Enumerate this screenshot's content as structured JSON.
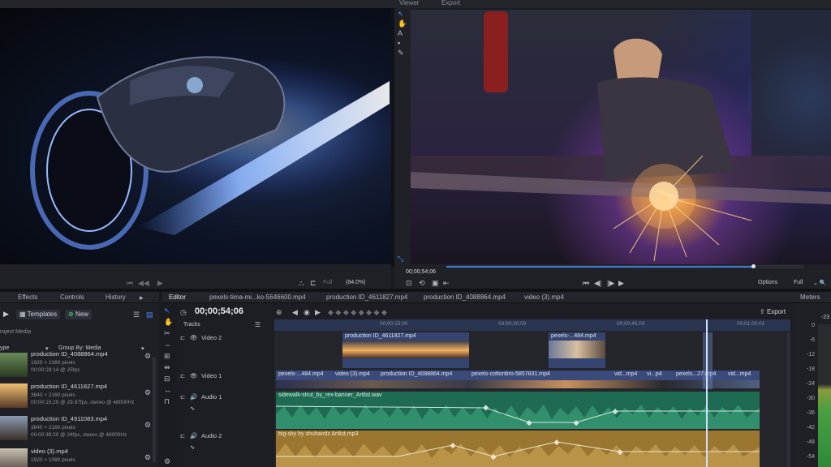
{
  "top": {
    "viewer_tab": "Viewer",
    "export_tab": "Export"
  },
  "source_viewer": {
    "transport": [
      "⏮",
      "◀◀",
      "▶"
    ],
    "zoom_label": "Full",
    "zoom_percent": "(84.0%)"
  },
  "program_viewer": {
    "timecode": "00;00;54;06",
    "options_label": "Options",
    "full_label": "Full",
    "progress": 0.86
  },
  "left_panel": {
    "tabs": [
      "Effects",
      "Controls",
      "History"
    ],
    "templates_label": "Templates",
    "new_label": "New",
    "section_label": "roject Media",
    "type_label": "ype",
    "group_by_label": "Group By: Media",
    "items": [
      {
        "name": "production ID_4088864.mp4",
        "line1": "1920 × 1080 pixels",
        "line2": "00:00:29:14 @ 25fps"
      },
      {
        "name": "production ID_4611827.mp4",
        "line1": "3840 × 2160 pixels",
        "line2": "00;00;15;29 @ 29.97fps, stereo @ 48000Hz"
      },
      {
        "name": "production ID_4911083.mp4",
        "line1": "3840 × 2160 pixels",
        "line2": "00:00:39:20 @ 24fps, stereo @ 48000Hz"
      },
      {
        "name": "video (3).mp4",
        "line1": "1920 × 1080 pixels",
        "line2": ""
      }
    ]
  },
  "editor": {
    "tabs": [
      "Editor",
      "pexels-tima-mi...ko-5646600.mp4",
      "production ID_4611827.mp4",
      "production ID_4088864.mp4",
      "video (3).mp4"
    ],
    "timecode": "00;00;54;06",
    "export_label": "Export",
    "tracks_label": "Tracks",
    "ruler": [
      "00;00;15;00",
      "00;00;30;00",
      "00;00;45;00",
      "00;01;00;01"
    ],
    "tracks": [
      {
        "name": "Video 2"
      },
      {
        "name": "Video 1"
      },
      {
        "name": "Audio 1"
      },
      {
        "name": "Audio 2"
      }
    ],
    "video2_clips": [
      "production ID_4611827.mp4",
      "pexels-...484.mp4"
    ],
    "video1_clips": [
      "pexels-...484.mp4",
      "video (3).mp4",
      "production ID_4088864.mp4",
      "pexels-cottonbro-5857831.mp4",
      "vid...mp4",
      "vi...p4",
      "pexels...27.mp4",
      "vid...mp4"
    ],
    "audio1_clip": "sidewalk-strut_by_rex-banner_Artlist.wav",
    "audio2_clip": "big-sky by shuhandz Artlist.mp3"
  },
  "meters": {
    "title": "Meters",
    "scale": [
      "-23",
      "0",
      "-6",
      "-12",
      "-18",
      "-24",
      "-30",
      "-36",
      "-42",
      "-48",
      "-54"
    ]
  },
  "colors": {
    "accent": "#3d7bd9",
    "video_clip": "#3a4a7a",
    "audio1": "#2f8a6a",
    "audio2": "#b08a3a",
    "playhead": "#9fc2ff"
  }
}
